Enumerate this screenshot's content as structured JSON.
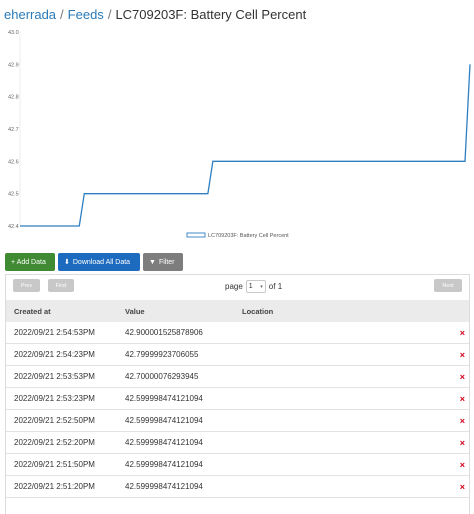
{
  "breadcrumb": {
    "user": "eherrada",
    "feeds": "Feeds",
    "sep1": "/",
    "sep2": "/",
    "title": "LC709203F: Battery Cell Percent"
  },
  "chart_data": {
    "type": "line",
    "title": "",
    "xlabel": "",
    "ylabel": "",
    "ylim": [
      42.4,
      43.0
    ],
    "yticks": [
      "43.0",
      "42.9",
      "42.8",
      "42.7",
      "42.6",
      "42.5",
      "42.4"
    ],
    "step": true,
    "series": [
      {
        "name": "LC709203F: Battery Cell Percent",
        "color": "#2f7fc1",
        "x": [
          0,
          1,
          2,
          3,
          4,
          5,
          6,
          7
        ],
        "values": [
          42.4,
          42.5,
          42.5,
          42.6,
          42.6,
          42.6,
          42.6,
          42.9
        ]
      }
    ],
    "legend": "bottom-center",
    "grid": false
  },
  "toolbar": {
    "add": "+ Add Data",
    "download": "Download All Data",
    "filter": "Filter",
    "download_icon": "download-icon",
    "filter_icon": "filter-icon"
  },
  "pager": {
    "prev": "Prev",
    "first": "First",
    "next": "Next",
    "page_label": "page",
    "page_value": "1",
    "of_label": "of 1"
  },
  "table": {
    "headers": {
      "created": "Created at",
      "value": "Value",
      "location": "Location"
    },
    "rows": [
      {
        "created": "2022/09/21 2:54:53PM",
        "value": "42.900001525878906",
        "location": ""
      },
      {
        "created": "2022/09/21 2:54:23PM",
        "value": "42.79999923706055",
        "location": ""
      },
      {
        "created": "2022/09/21 2:53:53PM",
        "value": "42.70000076293945",
        "location": ""
      },
      {
        "created": "2022/09/21 2:53:23PM",
        "value": "42.599998474121094",
        "location": ""
      },
      {
        "created": "2022/09/21 2:52:50PM",
        "value": "42.599998474121094",
        "location": ""
      },
      {
        "created": "2022/09/21 2:52:20PM",
        "value": "42.599998474121094",
        "location": ""
      },
      {
        "created": "2022/09/21 2:51:50PM",
        "value": "42.599998474121094",
        "location": ""
      },
      {
        "created": "2022/09/21 2:51:20PM",
        "value": "42.599998474121094",
        "location": ""
      }
    ],
    "delete_icon": "×"
  }
}
